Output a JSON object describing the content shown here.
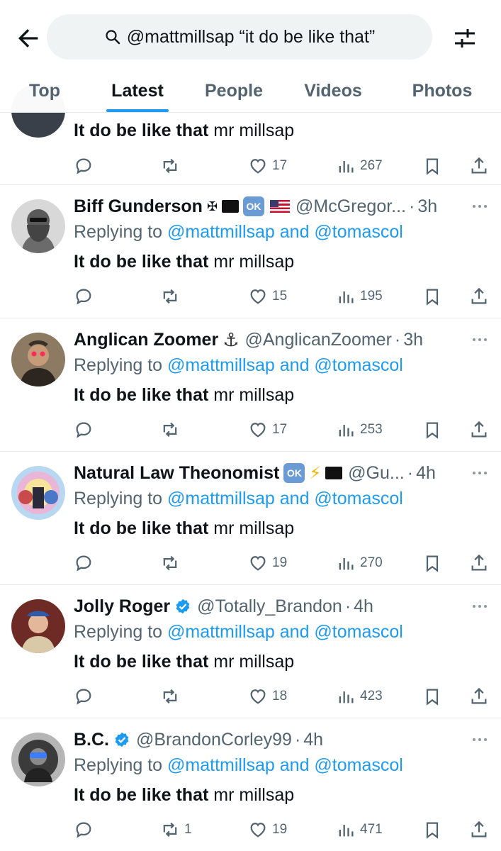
{
  "header": {
    "search_query": "@mattmillsap “it do be like that”"
  },
  "tabs": [
    {
      "label": "Top"
    },
    {
      "label": "Latest"
    },
    {
      "label": "People"
    },
    {
      "label": "Videos"
    },
    {
      "label": "Photos"
    }
  ],
  "active_tab": "Latest",
  "partial_post": {
    "body_bold": "It do be like that",
    "body_rest": " mr millsap",
    "likes": "17",
    "views": "267"
  },
  "posts": [
    {
      "name": "Biff Gunderson",
      "badges": [
        "cross",
        "black-flag",
        "ok",
        "us-flag"
      ],
      "handle": "@McGregor...",
      "time": "3h",
      "reply_prefix": "Replying to ",
      "reply_mentions": "@mattmillsap and @tomascol",
      "body_bold": "It do be like that",
      "body_rest": " mr millsap",
      "likes": "15",
      "views": "195",
      "reposts": ""
    },
    {
      "name": "Anglican Zoomer",
      "badges": [
        "anchor"
      ],
      "handle": "@AnglicanZoomer",
      "time": "3h",
      "reply_prefix": "Replying to ",
      "reply_mentions": "@mattmillsap and @tomascol",
      "body_bold": "It do be like that",
      "body_rest": " mr millsap",
      "likes": "17",
      "views": "253",
      "reposts": ""
    },
    {
      "name": "Natural Law Theonomist",
      "badges": [
        "ok",
        "bolt",
        "black-flag"
      ],
      "handle": "@Gu...",
      "time": "4h",
      "reply_prefix": "Replying to ",
      "reply_mentions": "@mattmillsap and @tomascol",
      "body_bold": "It do be like that",
      "body_rest": " mr millsap",
      "likes": "19",
      "views": "270",
      "reposts": ""
    },
    {
      "name": "Jolly Roger",
      "badges": [
        "verified"
      ],
      "handle": "@Totally_Brandon",
      "time": "4h",
      "reply_prefix": "Replying to ",
      "reply_mentions": "@mattmillsap and @tomascol",
      "body_bold": "It do be like that",
      "body_rest": " mr millsap",
      "likes": "18",
      "views": "423",
      "reposts": ""
    },
    {
      "name": "B.C.",
      "badges": [
        "verified"
      ],
      "handle": "@BrandonCorley99",
      "time": "4h",
      "reply_prefix": "Replying to ",
      "reply_mentions": "@mattmillsap and @tomascol",
      "body_bold": "It do be like that",
      "body_rest": " mr millsap",
      "likes": "19",
      "views": "471",
      "reposts": "1"
    }
  ],
  "badge_text": {
    "ok": "OK"
  },
  "colors": {
    "accent": "#1d9bf0",
    "muted": "#536471",
    "text": "#0f1419"
  },
  "icons": [
    "back-arrow-icon",
    "search-icon",
    "filter-icon",
    "more-icon",
    "reply-icon",
    "repost-icon",
    "like-icon",
    "views-icon",
    "bookmark-icon",
    "share-icon",
    "verified-icon"
  ]
}
